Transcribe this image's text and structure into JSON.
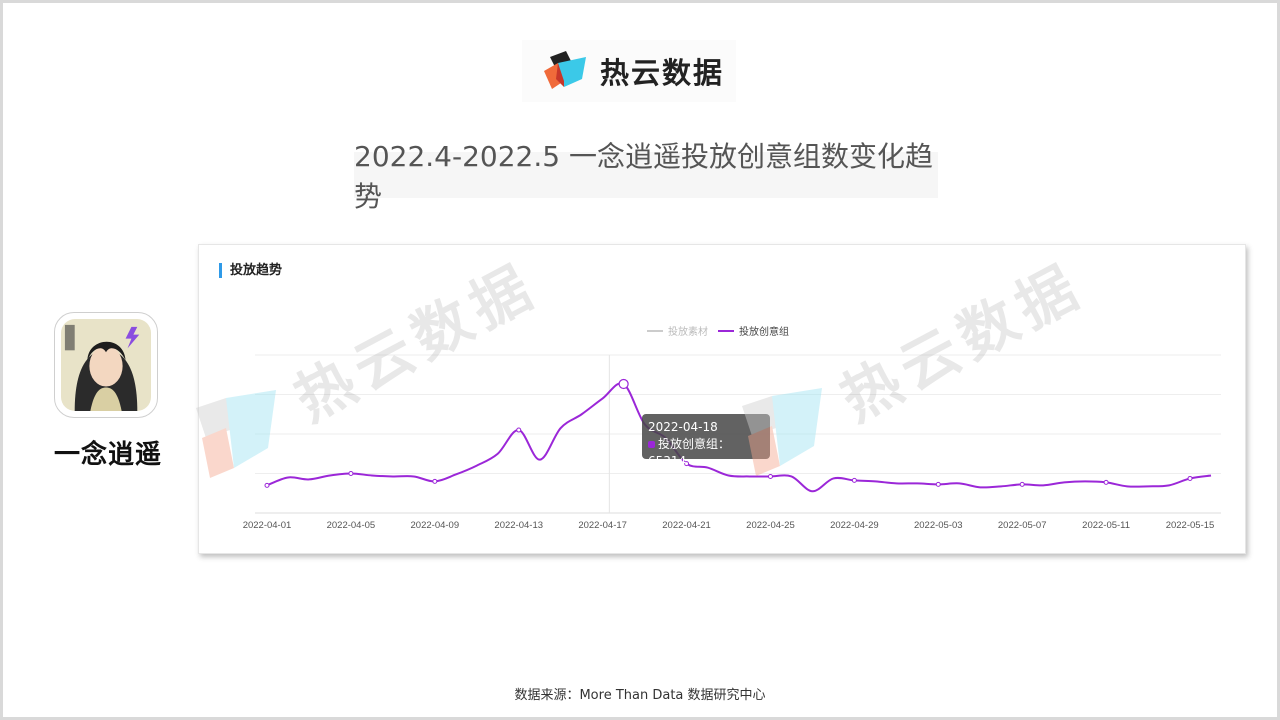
{
  "brand": {
    "name": "热云数据"
  },
  "page": {
    "title": "2022.4-2022.5 一念逍遥投放创意组数变化趋势"
  },
  "app": {
    "name": "一念逍遥"
  },
  "panel": {
    "title": "投放趋势"
  },
  "legend": [
    {
      "name": "投放素材",
      "color": "#cccccc"
    },
    {
      "name": "投放创意组",
      "color": "#9b27d8"
    }
  ],
  "tooltip": {
    "date": "2022-04-18",
    "series": "投放创意组",
    "value": "65314"
  },
  "watermark": "热云数据",
  "source": "数据来源：More Than Data 数据研究中心",
  "chart_data": {
    "type": "line",
    "x": [
      "2022-04-01",
      "2022-04-02",
      "2022-04-03",
      "2022-04-04",
      "2022-04-05",
      "2022-04-06",
      "2022-04-07",
      "2022-04-08",
      "2022-04-09",
      "2022-04-10",
      "2022-04-11",
      "2022-04-12",
      "2022-04-13",
      "2022-04-14",
      "2022-04-15",
      "2022-04-16",
      "2022-04-17",
      "2022-04-18",
      "2022-04-19",
      "2022-04-20",
      "2022-04-21",
      "2022-04-22",
      "2022-04-23",
      "2022-04-24",
      "2022-04-25",
      "2022-04-26",
      "2022-04-27",
      "2022-04-28",
      "2022-04-29",
      "2022-04-30",
      "2022-05-01",
      "2022-05-02",
      "2022-05-03",
      "2022-05-04",
      "2022-05-05",
      "2022-05-06",
      "2022-05-07",
      "2022-05-08",
      "2022-05-09",
      "2022-05-10",
      "2022-05-11",
      "2022-05-12",
      "2022-05-13",
      "2022-05-14",
      "2022-05-15",
      "2022-05-16"
    ],
    "xticks": [
      "2022-04-01",
      "2022-04-05",
      "2022-04-09",
      "2022-04-13",
      "2022-04-17",
      "2022-04-21",
      "2022-04-25",
      "2022-04-29",
      "2022-05-03",
      "2022-05-07",
      "2022-05-11",
      "2022-05-15"
    ],
    "series": [
      {
        "name": "投放创意组",
        "values": [
          14000,
          18000,
          17000,
          19000,
          20000,
          19000,
          18500,
          18500,
          16000,
          19500,
          24000,
          30000,
          42000,
          27000,
          43000,
          50000,
          58000,
          65314,
          45000,
          38000,
          25000,
          23000,
          19000,
          18500,
          18500,
          18500,
          11000,
          17500,
          16500,
          16000,
          15000,
          15000,
          14500,
          15000,
          13000,
          13500,
          14500,
          14000,
          15500,
          16000,
          15500,
          13500,
          13500,
          14000,
          17500,
          19000
        ]
      },
      {
        "name": "投放素材",
        "values": []
      }
    ],
    "ylim": [
      0,
      80000
    ],
    "grid": true,
    "legend": "top-center"
  }
}
